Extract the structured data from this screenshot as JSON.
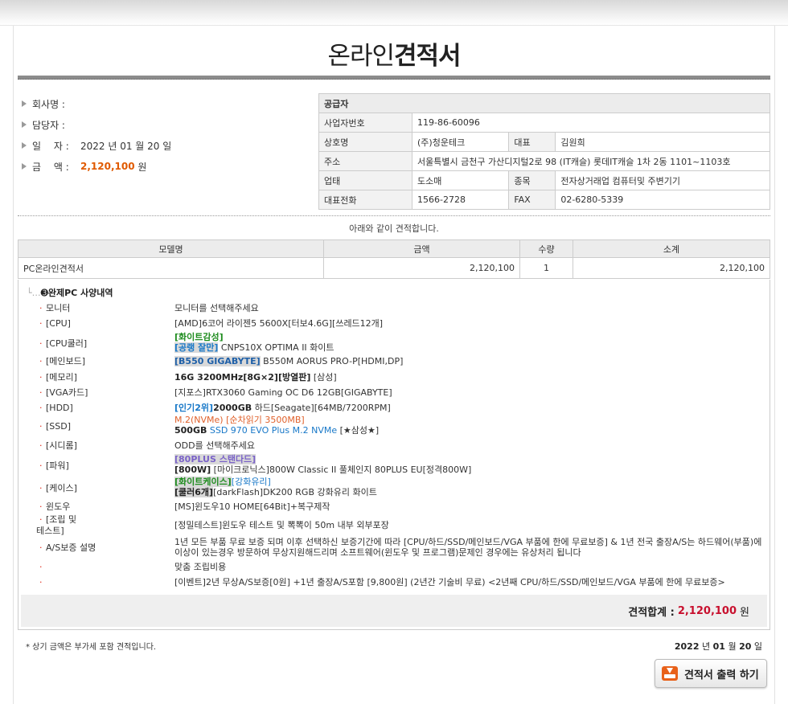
{
  "title_a": "온라인",
  "title_b": "견적서",
  "customer": {
    "company_label": "회사명 :",
    "manager_label": "담당자 :",
    "date_label": "일　 자 :",
    "date_value": "2022 년 01 월 20 일",
    "amount_label": "금　 액 :",
    "amount_value": "2,120,100",
    "amount_unit": "원"
  },
  "supplier": {
    "header": "공급자",
    "biz_no_label": "사업자번호",
    "biz_no": "119-86-60096",
    "company_label": "상호명",
    "company": "(주)청운테크",
    "ceo_label": "대표",
    "ceo": "김원희",
    "address_label": "주소",
    "address": "서울특별시 금천구 가산디지털2로 98 (IT캐슬) 롯데IT캐슬 1차 2동 1101~1103호",
    "business_label": "업태",
    "business": "도소매",
    "item_label": "종목",
    "item": "전자상거래업 컴퓨터및 주변기기",
    "tel_label": "대표전화",
    "tel": "1566-2728",
    "fax_label": "FAX",
    "fax": "02-6280-5339"
  },
  "subtitle": "아래와 같이 견적합니다.",
  "items_table": {
    "headers": [
      "모델명",
      "금액",
      "수량",
      "소계"
    ],
    "row": {
      "model": "PC온라인견적서",
      "price": "2,120,100",
      "qty": "1",
      "subtotal": "2,120,100"
    }
  },
  "spec": {
    "heading": "완제PC 사양내역",
    "monitor": {
      "name": "모니터",
      "value": "모니터를 선택해주세요"
    },
    "cpu": {
      "name": "[CPU]",
      "value": "[AMD]6코어 라이젠5 5600X[터보4.6G][쓰레드12개]"
    },
    "cooler": {
      "name": "[CPU쿨러]",
      "tag1": "[화이트감성]",
      "tag2": "[공랭 잘만]",
      "value": " CNPS10X OPTIMA II 화이트"
    },
    "board": {
      "name": "[메인보드]",
      "tag": "[B550 GIGABYTE]",
      "value": " B550M AORUS PRO-P[HDMI,DP]"
    },
    "memory": {
      "name": "[메모리]",
      "tag": "16G 3200MHz[8G×2][방열판]",
      "value": " [삼성]"
    },
    "vga": {
      "name": "[VGA카드]",
      "value": "[지포스]RTX3060 Gaming OC D6 12GB[GIGABYTE]"
    },
    "hdd": {
      "name": "[HDD]",
      "tag1": "[인기2위]",
      "tag2": "2000GB",
      "value": " 하드[Seagate][64MB/7200RPM]"
    },
    "ssd": {
      "name": "[SSD]",
      "line1": "M.2(NVMe) [순차읽기 3500MB]",
      "tag": "500GB",
      "model": " SSD 970 EVO Plus M.2 NVMe",
      "value": " [★삼성★]"
    },
    "odd": {
      "name": "[시디롬]",
      "value": "ODD를 선택해주세요"
    },
    "power": {
      "name": "[파워]",
      "tag1": "[80PLUS 스탠다드]",
      "tag2": "[800W]",
      "value": " [마이크로닉스]800W Classic II 풀체인지 80PLUS EU[정격800W]"
    },
    "case": {
      "name": "[케이스]",
      "tag1": "[화이트케이스]",
      "tag2": "[강화유리]",
      "tag3": "[쿨러6개]",
      "value": "[darkFlash]DK200 RGB 강화유리 화이트"
    },
    "os": {
      "name": "윈도우",
      "value": "[MS]윈도우10 HOME[64Bit]+복구제작"
    },
    "assembly": {
      "name1": "[조립 및",
      "name2": "테스트]",
      "value": "[정밀테스트]윈도우 테스트 및 뽁뽁이 50m 내부 외부포장"
    },
    "as": {
      "name": "A/S보증 설명",
      "value": "1년 모든 부품 무료 보증 되며 이후 선택하신 보증기간에 따라 [CPU/하드/SSD/메인보드/VGA 부품에 한에 무료보증] & 1년 전국 출장A/S는 하드웨어(부품)에 이상이 있는경우 방문하여 무상지원해드리며 소프트웨어(윈도우 및 프로그램)문제인 경우에는 유상처리 됩니다"
    },
    "custom": {
      "value": "맞춤 조립비용"
    },
    "event": {
      "value": "[이벤트]2년 무상A/S보증[0원] +1년 출장A/S포함 [9,800원] (2년간 기술비 무료) <2년째 CPU/하드/SSD/메인보드/VGA 부품에 한에 무료보증>"
    }
  },
  "total": {
    "label": "견적합계 :",
    "value": "2,120,100",
    "unit": "원"
  },
  "footer": {
    "note": "* 상기 금액은 부가세 포함 견적입니다.",
    "year": "2022",
    "year_unit": "년",
    "month": "01",
    "month_unit": "월",
    "day": "20",
    "day_unit": "일"
  },
  "print_button": "견적서 출력 하기",
  "colors": {
    "accent_orange": "#e05a00",
    "total_red": "#c8102e",
    "print_icon": "#e8611a"
  }
}
